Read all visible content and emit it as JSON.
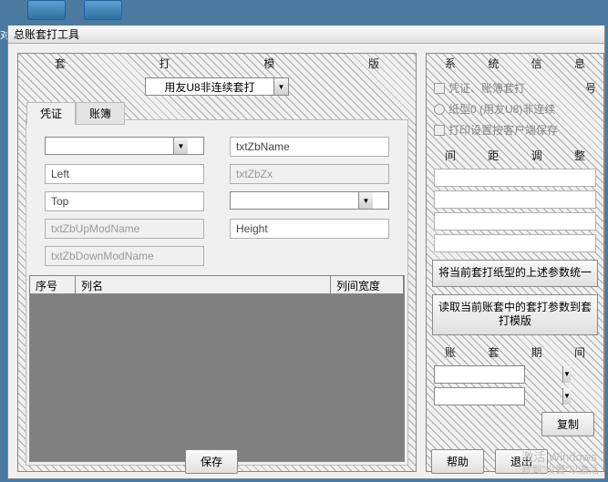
{
  "window": {
    "title": "总账套打工具"
  },
  "desktop": {
    "sideLabel": "对"
  },
  "mainPanel": {
    "headerChars": [
      "套",
      "打",
      "模",
      "版"
    ],
    "modeCombo": "用友U8非连续套打",
    "tabs": [
      "凭证",
      "账簿"
    ],
    "activeTab": 0,
    "fields": {
      "combo1": "",
      "zbName": "txtZbName",
      "left": "Left",
      "zbZx": "txtZbZx",
      "top": "Top",
      "combo2": "",
      "upMod": "txtZbUpModName",
      "height": "Height",
      "downMod": "txtZbDownModName"
    },
    "table": {
      "col1": "序号",
      "col2": "列名",
      "col3": "列间宽度"
    }
  },
  "rightPanel": {
    "headerChars": [
      "系",
      "统",
      "信",
      "息"
    ],
    "opt1": "凭证、账簿套打",
    "opt1suffix": "号",
    "opt2": "纸型0 (用友U8)非连续",
    "opt3": "打印设置按客户端保存",
    "subHeader": [
      "间",
      "距",
      "调",
      "整"
    ],
    "btn1": "将当前套打纸型的上述参数统一",
    "btn2": "读取当前账套中的套打参数到套打模版",
    "subHeader2": [
      "账",
      "套",
      "期",
      "间"
    ],
    "copy": "复制"
  },
  "bottom": {
    "save": "保存",
    "help": "帮助",
    "exit": "退出"
  },
  "watermark": {
    "line1": "激活 Windows",
    "line2": "转到\"设置\"以激活"
  }
}
